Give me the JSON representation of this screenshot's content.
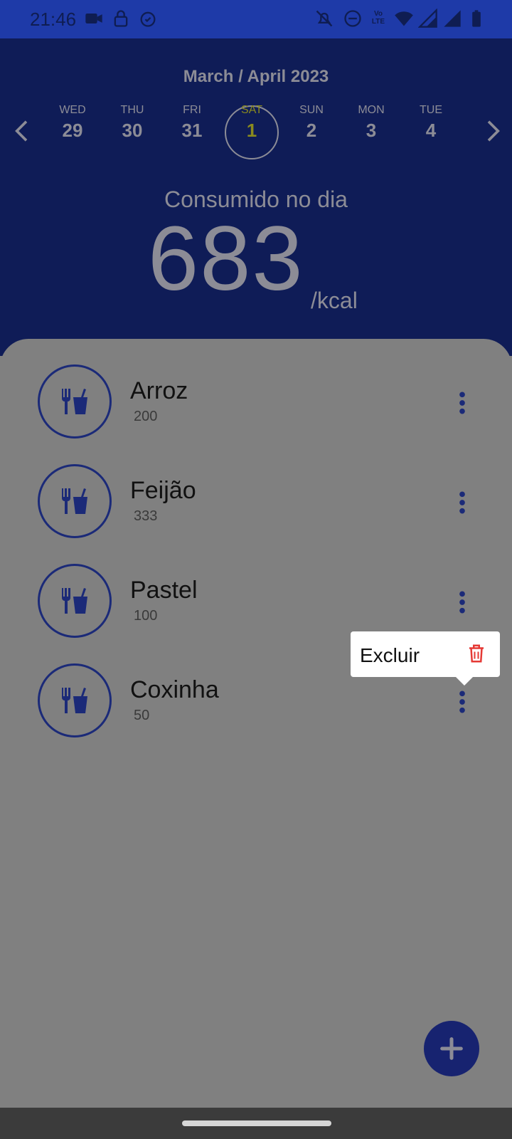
{
  "status_bar": {
    "time": "21:46",
    "icons": [
      "video-camera-icon",
      "lock-icon",
      "alarm-icon",
      "bell-off-icon",
      "do-not-disturb-icon",
      "volte-icon",
      "wifi-icon",
      "signal-icon",
      "signal-2-icon",
      "battery-icon"
    ],
    "volte_text": "Vo LTE"
  },
  "header": {
    "month_label": "March / April 2023",
    "days": [
      {
        "dow": "WED",
        "num": "29"
      },
      {
        "dow": "THU",
        "num": "30"
      },
      {
        "dow": "FRI",
        "num": "31"
      },
      {
        "dow": "SAT",
        "num": "1"
      },
      {
        "dow": "SUN",
        "num": "2"
      },
      {
        "dow": "MON",
        "num": "3"
      },
      {
        "dow": "TUE",
        "num": "4"
      }
    ],
    "consumed_label": "Consumido no dia",
    "consumed_value": "683",
    "unit": "/kcal"
  },
  "foods": [
    {
      "name": "Arroz",
      "kcal": "200"
    },
    {
      "name": "Feijão",
      "kcal": "333"
    },
    {
      "name": "Pastel",
      "kcal": "100"
    },
    {
      "name": "Coxinha",
      "kcal": "50"
    }
  ],
  "popup": {
    "label": "Excluir"
  },
  "colors": {
    "header_bg": "#0f1c57",
    "status_bg": "#1e3aa8",
    "accent": "#172370",
    "selected_day": "#8a8a1e",
    "delete": "#e53935",
    "overlay": "#808080"
  }
}
